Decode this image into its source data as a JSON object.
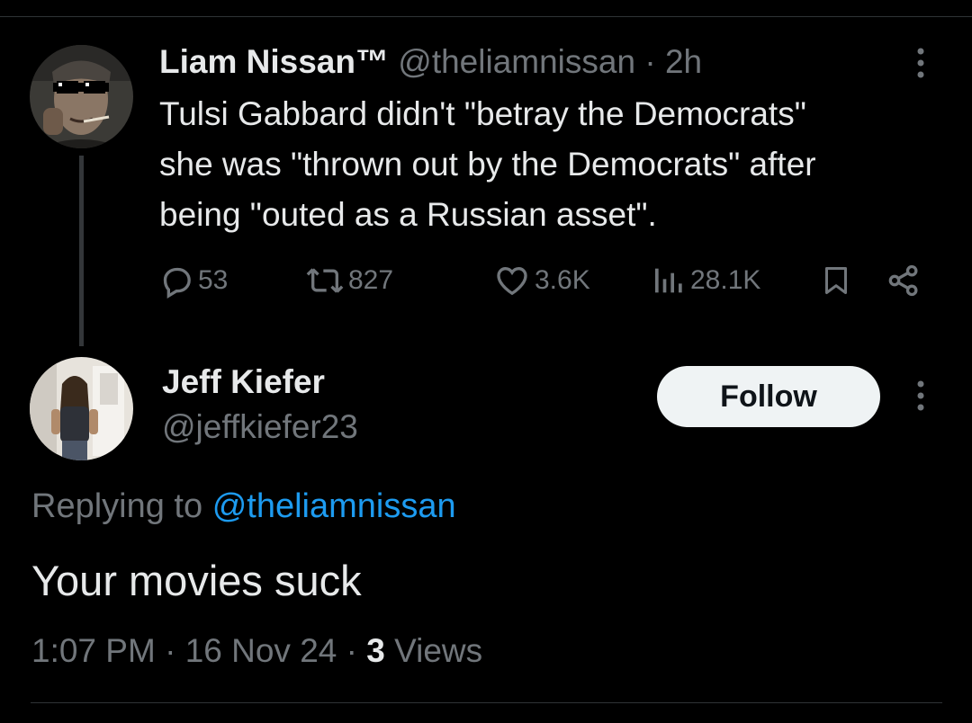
{
  "tweet": {
    "author_name": "Liam Nissan™",
    "author_handle": "@theliamnissan",
    "separator": "·",
    "time_ago": "2h",
    "text_lines": [
      "Tulsi Gabbard didn't \"betray the Democrats\"",
      "she was \"thrown out by the Democrats\" after",
      "being \"outed as a Russian asset\"."
    ],
    "stats": {
      "replies": "53",
      "retweets": "827",
      "likes": "3.6K",
      "views": "28.1K"
    }
  },
  "reply": {
    "author_name": "Jeff Kiefer",
    "author_handle": "@jeffkiefer23",
    "follow_label": "Follow",
    "replying_prefix": "Replying to",
    "replying_to": "@theliamnissan",
    "text": "Your movies suck",
    "time": "1:07 PM",
    "separator": "·",
    "date": "16 Nov 24",
    "views_count": "3",
    "views_label": "Views"
  },
  "icons": {
    "reply": "reply-icon",
    "retweet": "retweet-icon",
    "like": "heart-icon",
    "views": "analytics-icon",
    "bookmark": "bookmark-icon",
    "share": "share-icon",
    "more": "more-vertical-icon"
  },
  "colors": {
    "background": "#000000",
    "text": "#e7e9ea",
    "muted": "#71767b",
    "link": "#1d9bf0",
    "divider": "#2f3336",
    "follow_bg": "#eff3f4",
    "follow_text": "#0f1419"
  }
}
